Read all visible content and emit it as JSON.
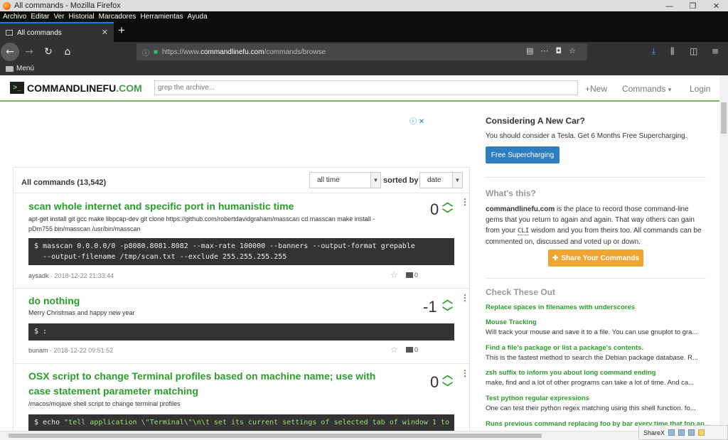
{
  "window": {
    "title": "All commands - Mozilla Firefox",
    "minimize": "—",
    "maximize": "❐",
    "close": "✕"
  },
  "menubar": [
    "Archivo",
    "Editar",
    "Ver",
    "Historial",
    "Marcadores",
    "Herramientas",
    "Ayuda"
  ],
  "tab": {
    "label": "All commands",
    "close": "✕",
    "new": "+"
  },
  "nav": {
    "url_prefix": "https://www.",
    "url_domain": "commandlinefu.com",
    "url_path": "/commands/browse"
  },
  "bookmarks": {
    "folder": "Menú"
  },
  "site": {
    "logo_mark": ">_",
    "logo_main": "COMMANDLINEFU",
    "logo_com": ".COM",
    "search_placeholder": "grep the archive...",
    "nav_new": "+New",
    "nav_commands": "Commands",
    "nav_commands_caret": "▾",
    "nav_login": "Login"
  },
  "list": {
    "title": "All commands (13,542)",
    "period": "all time",
    "sorted_label": "sorted by",
    "sort": "date"
  },
  "entries": [
    {
      "title": "scan whole internet and specific port in humanistic time",
      "desc": "apt-get install git gcc make libpcap-dev git clone https://github.com/robertdavidgraham/masscan cd masscan make install -pDm755 bin/masscan /usr/bin/masscan",
      "code_line1": "$ masscan 0.0.0.0/0 -p8080.8081.8082 --max-rate 100000 --banners --output-format grepable",
      "code_line2": "  --output-filename /tmp/scan.txt --exclude 255.255.255.255",
      "user": "aysadk",
      "date": "· 2018-12-22 21:33:44",
      "votes": "0",
      "comments": "0"
    },
    {
      "title": "do nothing",
      "desc": "Merry Christmas and happy new year",
      "code_line1": "$ :",
      "user": "bunam",
      "date": "· 2018-12-22 09:51:52",
      "votes": "-1",
      "comments": "0"
    },
    {
      "title_line1": "OSX script to change Terminal profiles based on machine name; use with",
      "title_line2": "case statement parameter matching",
      "desc": "/macos/mojave shell script to change terminal profiles",
      "code_prefix": "$ echo ",
      "code_string": "\"tell application \\\"Terminal\\\"\\n\\t set its current settings of selected tab of window 1 to",
      "votes": "0"
    }
  ],
  "sidebar": {
    "ad_title": "Considering A New Car?",
    "ad_text": "You should consider a Tesla. Get 6 Months Free Supercharging.",
    "ad_button": "Free Supercharging",
    "what_title": "What's this?",
    "what_brand": "commandlinefu.com",
    "what_text_1": " is the place to record those command-line gems that you return to again and again. That way others can gain from your ",
    "what_kbd": "CLI",
    "what_text_2": " wisdom and you from theirs too. All commands can be commented on, discussed and voted up or down.",
    "share_button": "Share Your Commands",
    "check_title": "Check These Out",
    "check_items": [
      {
        "title": "Replace spaces in filenames with underscores",
        "desc": ""
      },
      {
        "title": "Mouse Tracking",
        "desc": "Will track your mouse and save it to a file. You can use gnuplot to gra..."
      },
      {
        "title": "Find a file's package or list a package's contents.",
        "desc": "This is the fastest method to search the Debian package database. R..."
      },
      {
        "title": "zsh suffix to inform you about long command ending",
        "desc": "make, find and a lot of other programs can take a lot of time. And ca..."
      },
      {
        "title": "Test python regular expressions",
        "desc": "One can test their python regex matching using this shell function. fo..."
      },
      {
        "title": "Runs previous command replacing foo by bar every time that foo ap...",
        "desc": ""
      }
    ]
  },
  "sharex": {
    "label": "ShareX"
  }
}
